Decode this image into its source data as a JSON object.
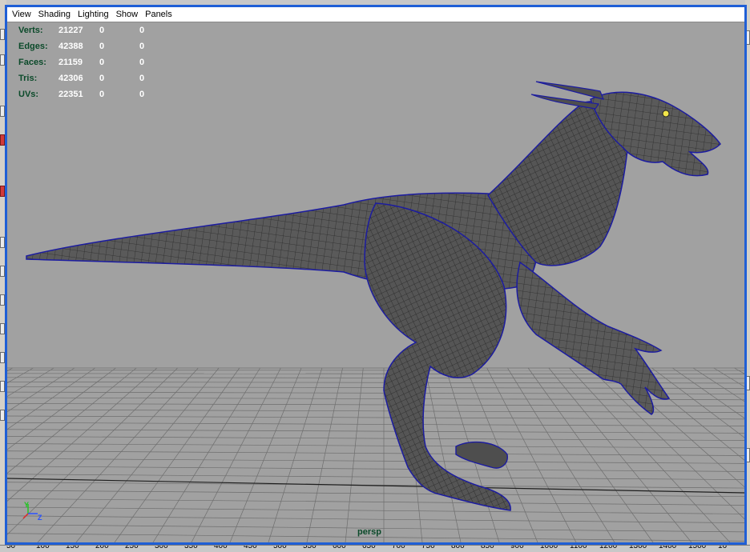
{
  "menu": {
    "items": [
      "View",
      "Shading",
      "Lighting",
      "Show",
      "Panels"
    ]
  },
  "hud": {
    "rows": [
      {
        "label": "Verts:",
        "value": "21227",
        "c1": "0",
        "c2": "0"
      },
      {
        "label": "Edges:",
        "value": "42388",
        "c1": "0",
        "c2": "0"
      },
      {
        "label": "Faces:",
        "value": "21159",
        "c1": "0",
        "c2": "0"
      },
      {
        "label": "Tris:",
        "value": "42306",
        "c1": "0",
        "c2": "0"
      },
      {
        "label": "UVs:",
        "value": "22351",
        "c1": "0",
        "c2": "0"
      }
    ]
  },
  "viewport": {
    "camera": "persp",
    "axis_y": "Y",
    "axis_z": "Z",
    "colors": {
      "background": "#a1a1a1",
      "grid": "#6e6e6e",
      "grid_axis": "#1e1e1e",
      "mesh_fill": "#5a5a5a",
      "mesh_wire": "#2a2a2a",
      "mesh_outline": "#1c1ca0",
      "eye": "#f2e64a"
    }
  },
  "ruler": {
    "labels": [
      "50",
      "100",
      "150",
      "200",
      "250",
      "300",
      "350",
      "400",
      "450",
      "500",
      "550",
      "600",
      "650",
      "700",
      "750",
      "800",
      "850",
      "900",
      "1000",
      "1100",
      "1200",
      "1300",
      "1400",
      "1500",
      "16"
    ]
  },
  "theme": {
    "active_border": "#1f5fd6"
  }
}
